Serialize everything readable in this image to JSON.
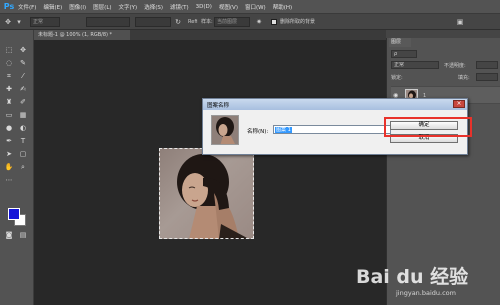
{
  "app": {
    "logo": "Ps"
  },
  "menu": [
    "文件(F)",
    "编辑(E)",
    "图像(I)",
    "图层(L)",
    "文字(Y)",
    "选择(S)",
    "滤镜(T)",
    "3D(D)",
    "视图(V)",
    "窗口(W)",
    "帮助(H)"
  ],
  "options_bar": {
    "mode_value": "正常",
    "mode_label": "模式:",
    "feather_value": "",
    "style_value": "",
    "refine_label": "Refi",
    "sample_label": "样本:",
    "sample_value": "当前图层",
    "sample_all_label": "删除所取的背景"
  },
  "document_tab": {
    "title": "未标题-1 @ 100% (1, RGB/8) *"
  },
  "toolbar": {
    "foreground_color": "#1414d8",
    "background_color": "#ffffff"
  },
  "layers_panel": {
    "tab_label": "图层",
    "blend_mode": "正常",
    "opacity_label": "不透明度:",
    "lock_label": "锁定:",
    "fill_label": "填充:",
    "layer_name": "1"
  },
  "dialog": {
    "title": "图案名称",
    "name_label": "名称(N):",
    "name_value": "图案 1",
    "ok_label": "确定",
    "cancel_label": "取消"
  },
  "watermark": {
    "main": "Bai du 经验",
    "sub": "jingyan.baidu.com"
  },
  "colors": {
    "highlight": "#e8322b",
    "brand_blue": "#31a8ff"
  }
}
